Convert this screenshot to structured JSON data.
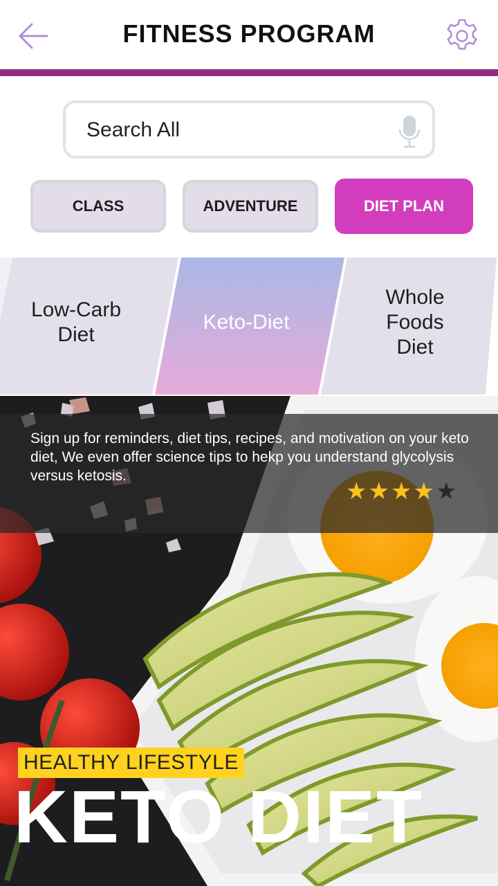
{
  "header": {
    "title": "FITNESS PROGRAM",
    "back_icon": "arrow-left-icon",
    "settings_icon": "gear-icon",
    "accent_color": "#8e2f82",
    "icon_color": "#b090d8"
  },
  "search": {
    "placeholder": "Search All",
    "value": "",
    "mic_icon": "microphone-icon"
  },
  "categories": [
    {
      "label": "CLASS",
      "selected": false
    },
    {
      "label": "ADVENTURE",
      "selected": false
    },
    {
      "label": "DIET PLAN",
      "selected": true
    }
  ],
  "category_active_color": "#d13dbd",
  "diet_tabs": [
    {
      "lines": [
        "Low-Carb",
        "Diet"
      ],
      "active": false
    },
    {
      "lines": [
        "Keto-Diet"
      ],
      "active": true
    },
    {
      "lines": [
        "Whole",
        "Foods",
        "Diet"
      ],
      "active": false
    }
  ],
  "hero": {
    "description": "Sign up for reminders, diet tips, recipes, and motivation on your keto diet, We even offer science tips  to hekp you understand glycolysis versus ketosis.",
    "rating": {
      "value": 4,
      "max": 5
    },
    "tag": "HEALTHY LIFESTYLE",
    "headline": "KETO DIET",
    "tag_color": "#ffd21f",
    "star_color": "#f7c21b"
  }
}
